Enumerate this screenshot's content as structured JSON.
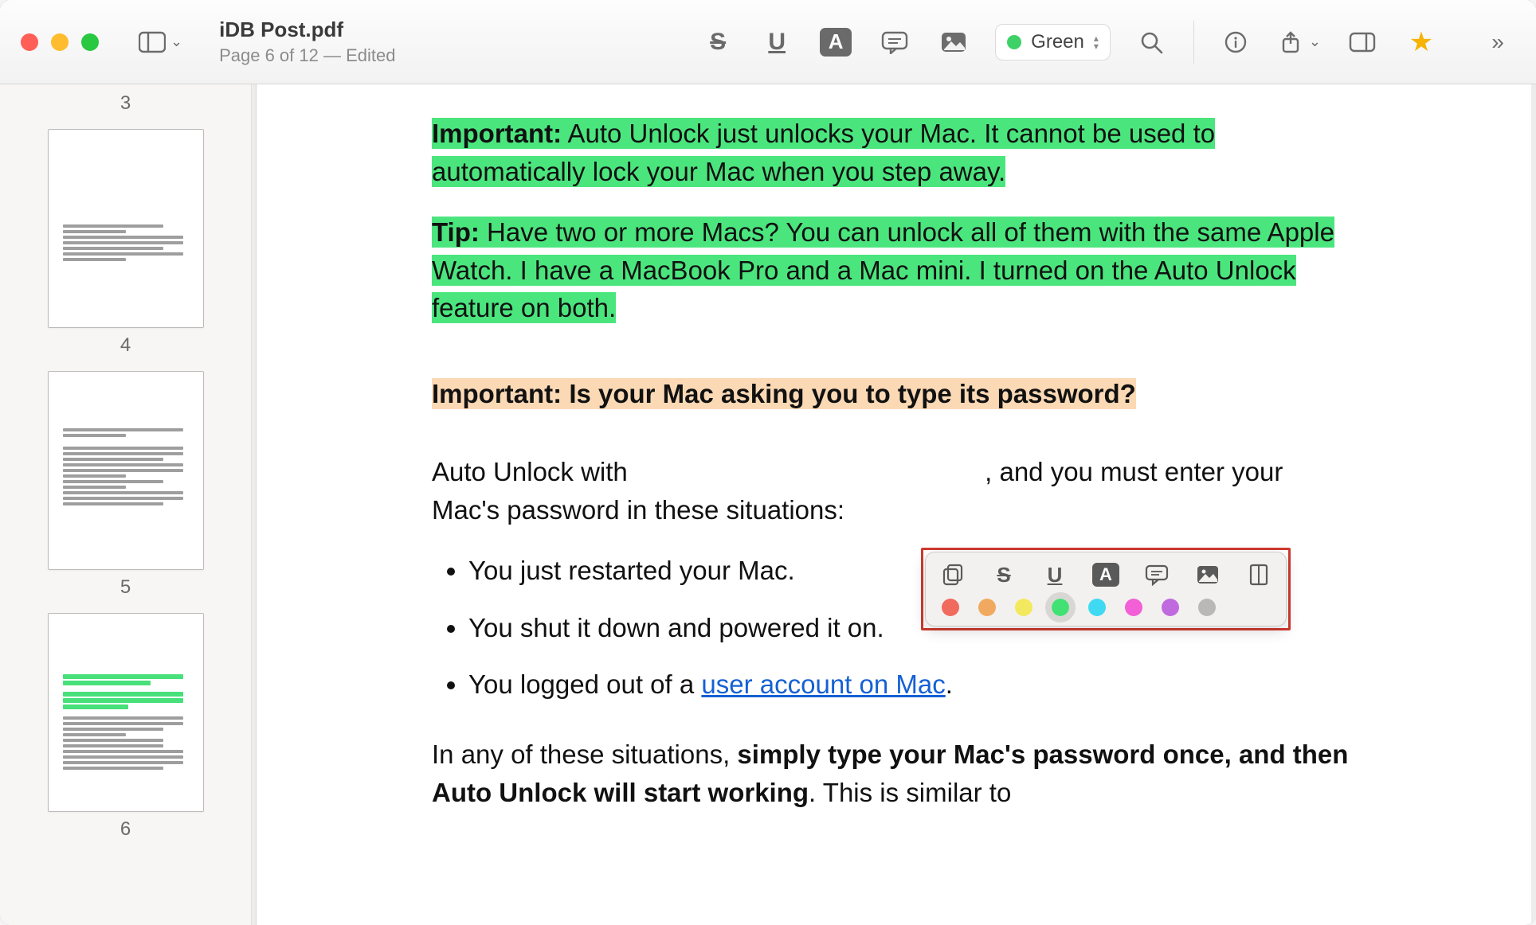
{
  "window": {
    "title": "iDB Post.pdf",
    "subtitle": "Page 6 of 12 — Edited"
  },
  "toolbar": {
    "highlight_label": "Green"
  },
  "sidebar": {
    "thumbs": [
      "3",
      "4",
      "5",
      "6"
    ]
  },
  "content": {
    "p1_bold": "Important:",
    "p1_rest": " Auto Unlock just unlocks your Mac. It cannot be used to automatically lock your Mac when you step away.",
    "p2_bold": "Tip:",
    "p2_rest": " Have two or more Macs? You can unlock all of them with the same Apple Watch. I have a MacBook Pro and a Mac mini. I turned on the Auto Unlock feature on both.",
    "p3": "Important: Is your Mac asking you to type its password?",
    "p4_a": "Auto Unlock with",
    "p4_b": ", and you must enter your Mac's password in these situations:",
    "bullets": {
      "b1": "You just restarted your Mac.",
      "b2": "You shut it down and powered it on.",
      "b3_a": "You logged out of a ",
      "b3_link": "user account on Mac",
      "b3_b": "."
    },
    "p5_a": "In any of these situations, ",
    "p5_bold": "simply type your Mac's password once, and then Auto Unlock will start working",
    "p5_b": ". This is similar to"
  },
  "popup": {
    "colors": [
      "#f06a5e",
      "#f0a95e",
      "#f3e95e",
      "#41e174",
      "#3fd9f2",
      "#f25fd6",
      "#c06adf",
      "#b9b8b6"
    ],
    "selected_index": 3
  }
}
